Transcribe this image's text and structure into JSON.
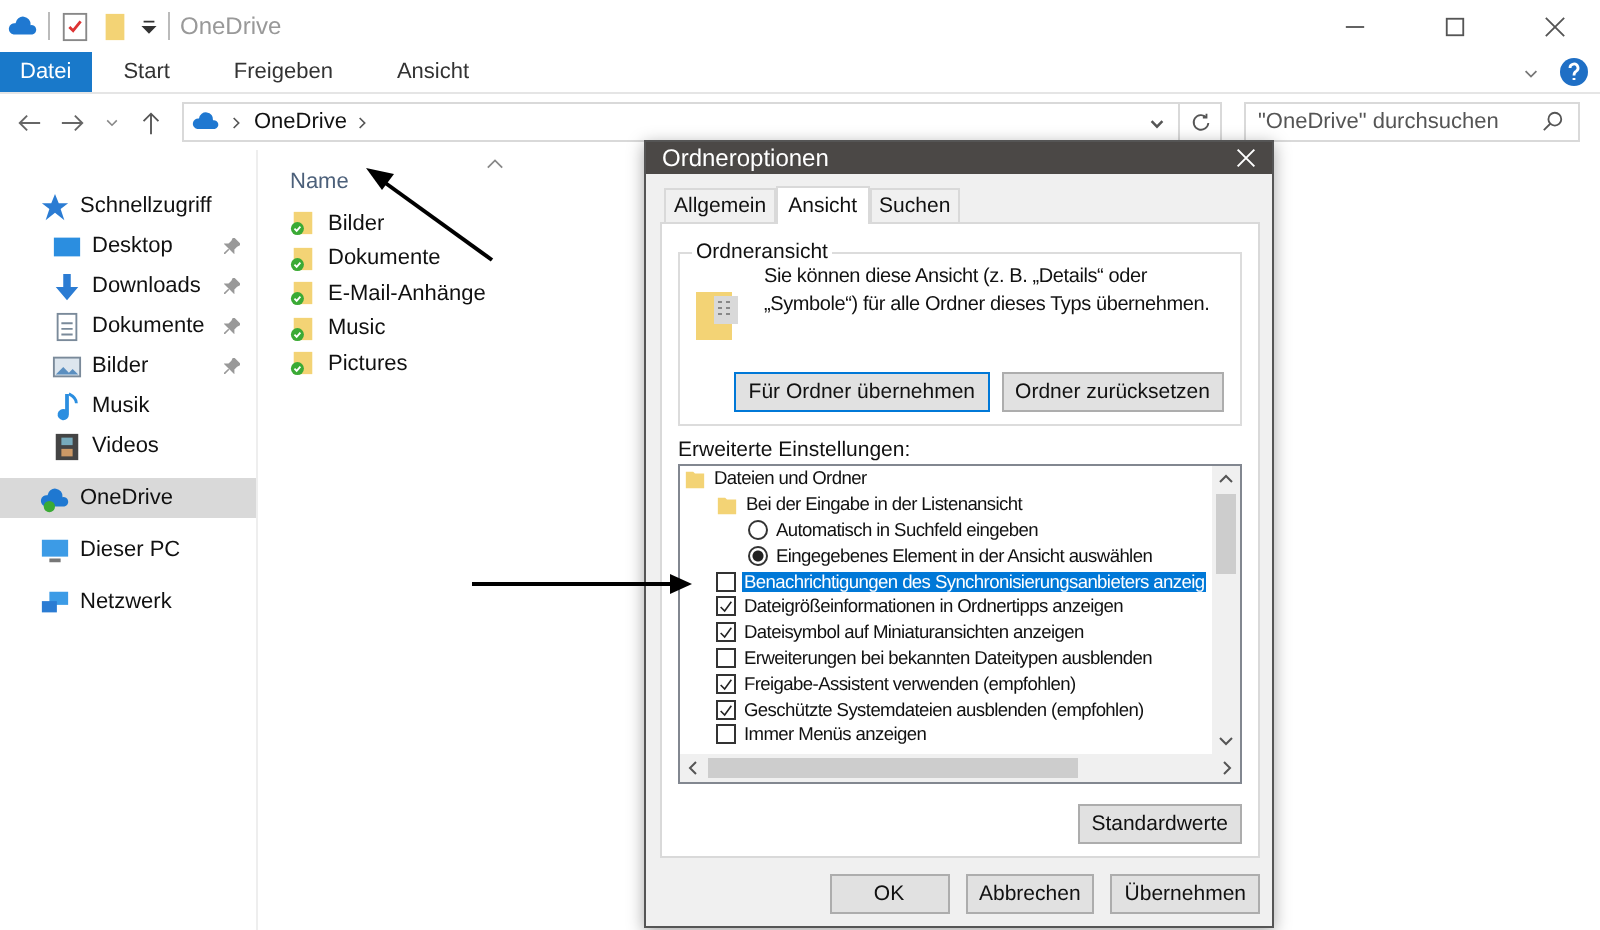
{
  "window": {
    "title": "OneDrive"
  },
  "ribbon": {
    "tabs": [
      {
        "label": "Datei",
        "kind": "file"
      },
      {
        "label": "Start",
        "kind": "tab"
      },
      {
        "label": "Freigeben",
        "kind": "tab"
      },
      {
        "label": "Ansicht",
        "kind": "tab"
      }
    ]
  },
  "address_bar": {
    "path": [
      "OneDrive"
    ],
    "search": {
      "placeholder": "\"OneDrive\" durchsuchen"
    }
  },
  "sidebar": {
    "items": [
      {
        "label": "Schnellzugriff",
        "kind": "star",
        "selected": false,
        "children": [
          {
            "label": "Desktop",
            "kind": "desktop",
            "pinned": true,
            "selected": false
          },
          {
            "label": "Downloads",
            "kind": "download",
            "pinned": true,
            "selected": false
          },
          {
            "label": "Dokumente",
            "kind": "document",
            "pinned": true,
            "selected": false
          },
          {
            "label": "Bilder",
            "kind": "picture",
            "pinned": true,
            "selected": false
          },
          {
            "label": "Musik",
            "kind": "music",
            "pinned": false,
            "selected": false
          },
          {
            "label": "Videos",
            "kind": "video",
            "pinned": false,
            "selected": false
          }
        ]
      },
      {
        "label": "OneDrive",
        "kind": "cloud",
        "selected": true
      },
      {
        "label": "Dieser PC",
        "kind": "pc",
        "selected": false
      },
      {
        "label": "Netzwerk",
        "kind": "network",
        "selected": false
      }
    ]
  },
  "file_list": {
    "columns": [
      "Name"
    ],
    "rows": [
      "Bilder",
      "Dokumente",
      "E-Mail-Anhänge",
      "Music",
      "Pictures"
    ]
  },
  "dialog": {
    "title": "Ordneroptionen",
    "tabs": [
      {
        "label": "Allgemein",
        "selected": false
      },
      {
        "label": "Ansicht",
        "selected": true
      },
      {
        "label": "Suchen",
        "selected": false
      }
    ],
    "folder_view": {
      "heading": "Ordneransicht",
      "text": "Sie können diese Ansicht (z. B. „Details“ oder „Symbole“) für alle Ordner dieses Typs übernehmen.",
      "buttons": [
        "Für Ordner übernehmen",
        "Ordner zurücksetzen"
      ]
    },
    "advanced": {
      "heading": "Erweiterte Einstellungen:",
      "items": [
        {
          "kind": "folder",
          "label": "Dateien und Ordner",
          "selected": false,
          "children": [
            {
              "kind": "folder",
              "label": "Bei der Eingabe in der Listenansicht",
              "selected": false,
              "children": [
                {
                  "kind": "radio",
                  "label": "Automatisch in Suchfeld eingeben",
                  "checked": false,
                  "selected": false
                },
                {
                  "kind": "radio",
                  "label": "Eingegebenes Element in der Ansicht auswählen",
                  "checked": true,
                  "selected": false
                }
              ]
            },
            {
              "kind": "checkbox",
              "label": "Benachrichtigungen des Synchronisierungsanbieters anzeig",
              "checked": false,
              "selected": true
            },
            {
              "kind": "checkbox",
              "label": "Dateigrößeinformationen in Ordnertipps anzeigen",
              "checked": true,
              "selected": false
            },
            {
              "kind": "checkbox",
              "label": "Dateisymbol auf Miniaturansichten anzeigen",
              "checked": true,
              "selected": false
            },
            {
              "kind": "checkbox",
              "label": "Erweiterungen bei bekannten Dateitypen ausblenden",
              "checked": false,
              "selected": false
            },
            {
              "kind": "checkbox",
              "label": "Freigabe-Assistent verwenden (empfohlen)",
              "checked": true,
              "selected": false
            },
            {
              "kind": "checkbox",
              "label": "Geschützte Systemdateien ausblenden (empfohlen)",
              "checked": true,
              "selected": false
            },
            {
              "kind": "checkbox",
              "label": "Immer Menüs anzeigen",
              "checked": false,
              "selected": false
            }
          ]
        }
      ],
      "restore_button": "Standardwerte"
    },
    "buttons": [
      "OK",
      "Abbrechen",
      "Übernehmen"
    ]
  }
}
